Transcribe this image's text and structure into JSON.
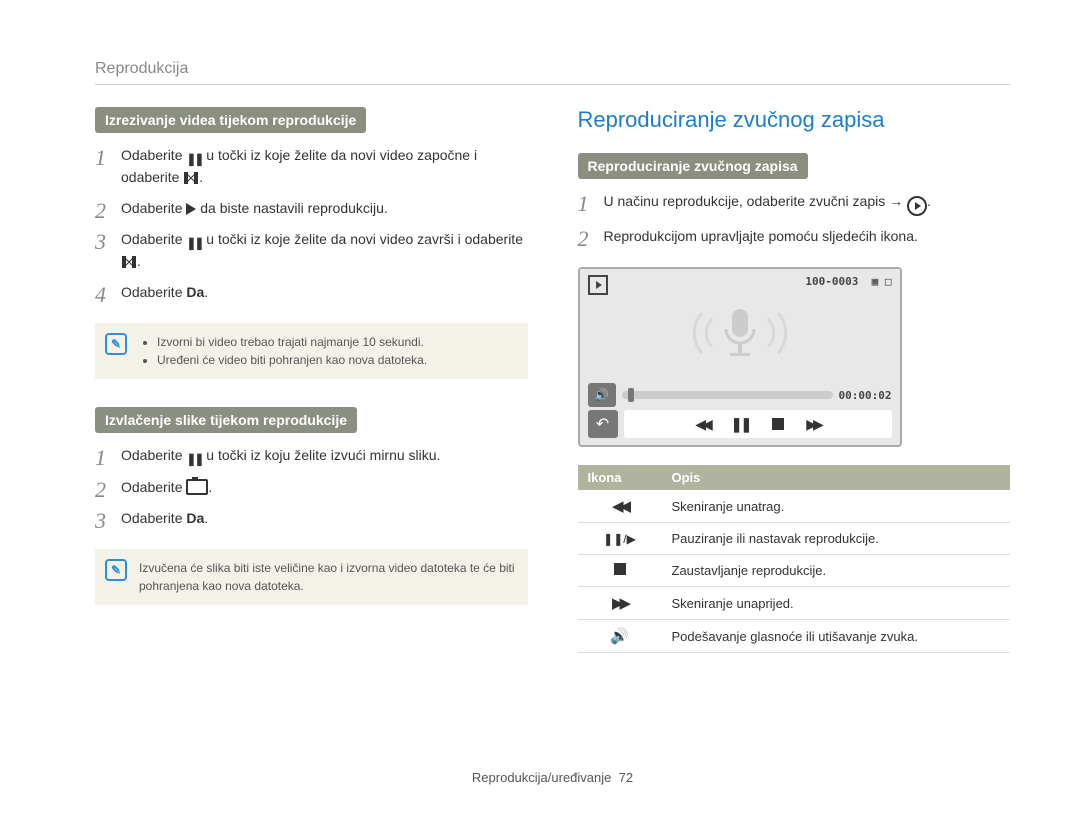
{
  "header": {
    "section": "Reprodukcija"
  },
  "left": {
    "sub1": "Izrezivanje videa tijekom reprodukcije",
    "steps1": [
      {
        "num": "1",
        "pre": "Odaberite ",
        "mid": " u točki iz koje želite da novi video započne i odaberite ",
        "post": "."
      },
      {
        "num": "2",
        "pre": "Odaberite ",
        "post": " da biste nastavili reprodukciju."
      },
      {
        "num": "3",
        "pre": "Odaberite ",
        "mid": " u točki iz koje želite da novi video završi i odaberite ",
        "post": "."
      },
      {
        "num": "4",
        "pre": "Odaberite ",
        "bold": "Da",
        "post": "."
      }
    ],
    "note1": {
      "bullets": [
        "Izvorni bi video trebao trajati najmanje 10 sekundi.",
        "Uređeni će video biti pohranjen kao nova datoteka."
      ]
    },
    "sub2": "Izvlačenje slike tijekom reprodukcije",
    "steps2": [
      {
        "num": "1",
        "pre": "Odaberite ",
        "post": " u točki iz koju želite izvući mirnu sliku."
      },
      {
        "num": "2",
        "pre": "Odaberite ",
        "post": "."
      },
      {
        "num": "3",
        "pre": "Odaberite ",
        "bold": "Da",
        "post": "."
      }
    ],
    "note2": {
      "text": "Izvučena će slika biti iste veličine kao i izvorna video datoteka te će biti pohranjena kao nova datoteka."
    }
  },
  "right": {
    "title": "Reproduciranje zvučnog zapisa",
    "sub": "Reproduciranje zvučnog zapisa",
    "steps": [
      {
        "num": "1",
        "pre": "U načinu reprodukcije, odaberite zvučni zapis → ",
        "post": "."
      },
      {
        "num": "2",
        "text": "Reprodukcijom upravljajte pomoću sljedećih ikona."
      }
    ],
    "player": {
      "counter": "100-0003",
      "time": "00:00:02"
    },
    "table": {
      "head": {
        "c1": "Ikona",
        "c2": "Opis"
      },
      "rows": [
        {
          "icon": "rw",
          "desc": "Skeniranje unatrag."
        },
        {
          "icon": "pauseplay",
          "desc": "Pauziranje ili nastavak reprodukcije."
        },
        {
          "icon": "stop",
          "desc": "Zaustavljanje reprodukcije."
        },
        {
          "icon": "ff",
          "desc": "Skeniranje unaprijed."
        },
        {
          "icon": "speaker",
          "desc": "Podešavanje glasnoće ili utišavanje zvuka."
        }
      ]
    }
  },
  "footer": {
    "text": "Reprodukcija/uređivanje",
    "page": "72"
  }
}
